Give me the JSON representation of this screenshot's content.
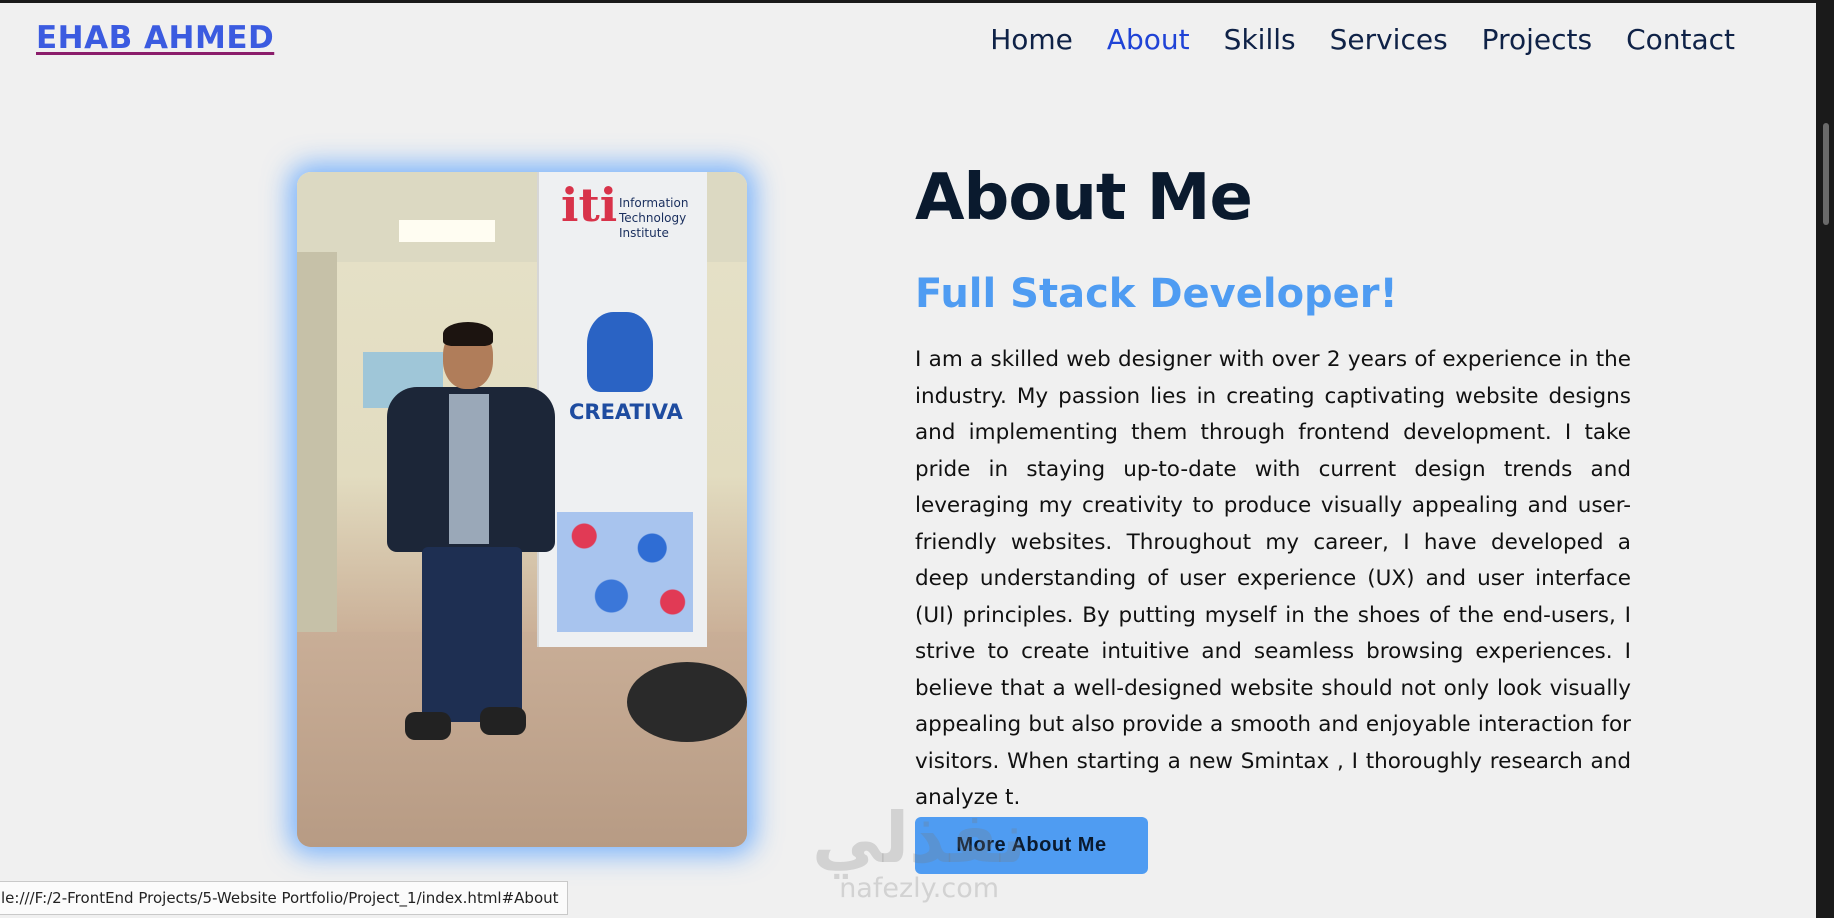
{
  "header": {
    "logo": "EHAB AHMED",
    "nav": [
      {
        "label": "Home"
      },
      {
        "label": "About",
        "active": true
      },
      {
        "label": "Skills"
      },
      {
        "label": "Services"
      },
      {
        "label": "Projects"
      },
      {
        "label": "Contact"
      }
    ]
  },
  "about": {
    "title": "About Me",
    "subtitle": "Full Stack Developer!",
    "paragraph": "I am a skilled web designer with over 2 years of experience in the industry. My passion lies in creating captivating website designs and implementing them through frontend development. I take pride in staying up-to-date with current design trends and leveraging my creativity to produce visually appealing and user-friendly websites. Throughout my career, I have developed a deep understanding of user experience (UX) and user interface (UI) principles. By putting myself in the shoes of the end-users, I strive to create intuitive and seamless browsing experiences. I believe that a well-designed website should not only look visually appealing but also provide a smooth and enjoyable interaction for visitors. When starting a new Smintax , I thoroughly research and analyze t.",
    "button_label": "More About Me",
    "photo": {
      "banner_org": "Information Technology Institute",
      "banner_logo": "iti",
      "banner_brand": "CREATIVA"
    }
  },
  "watermark": {
    "arabic": "نفذلي",
    "domain": "nafezly.com"
  },
  "status_bar": {
    "url": "le:///F:/2-FrontEnd Projects/5-Website Portfolio/Project_1/index.html#About"
  },
  "colors": {
    "accent": "#4f9cf2",
    "nav_active": "#1f43d6",
    "logo": "#3b5be0",
    "background": "#f0f0f0"
  }
}
